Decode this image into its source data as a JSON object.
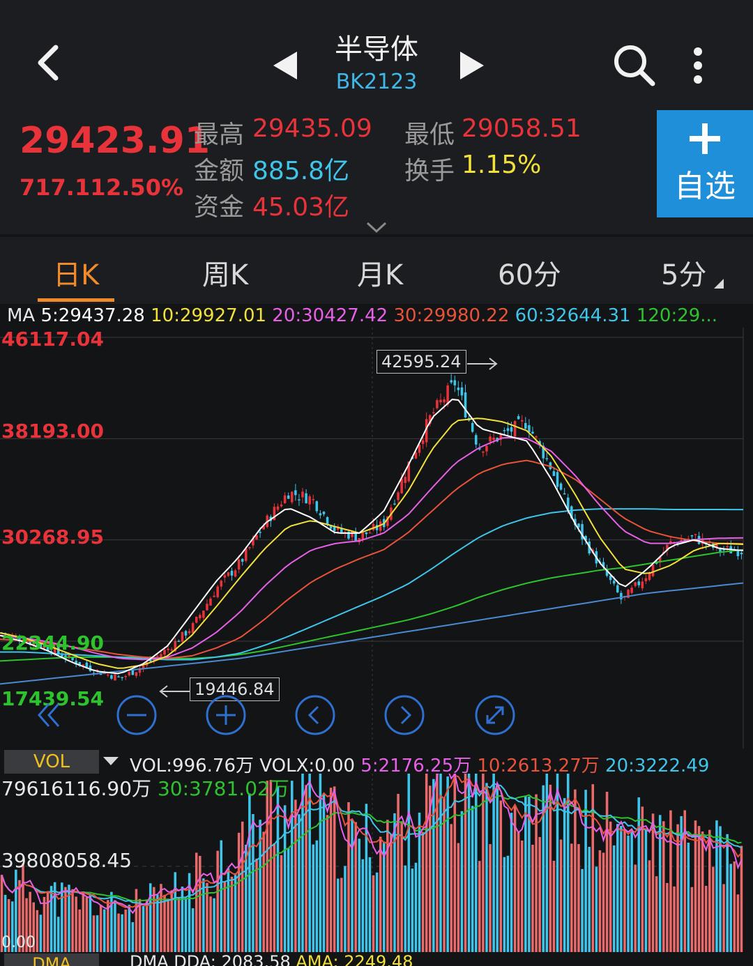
{
  "header": {
    "title": "半导体",
    "code": "BK2123"
  },
  "quote": {
    "price": "29423.91",
    "change": "717.11",
    "change_pct": "2.50%",
    "high_label": "最高",
    "high": "29435.09",
    "low_label": "最低",
    "low": "29058.51",
    "amount_label": "金额",
    "amount": "885.8亿",
    "turnover_label": "换手",
    "turnover": "1.15%",
    "capital_label": "资金",
    "capital": "45.03亿",
    "add_button_label": "自选"
  },
  "tabs": [
    {
      "label": "日K",
      "active": true
    },
    {
      "label": "周K",
      "active": false
    },
    {
      "label": "月K",
      "active": false
    },
    {
      "label": "60分",
      "active": false
    },
    {
      "label": "5分",
      "active": false
    }
  ],
  "ma": {
    "prefix": "MA",
    "ma5": "5:29437.28",
    "ma10": "10:29927.01",
    "ma20": "20:30427.42",
    "ma30": "30:29980.22",
    "ma60": "60:32644.31",
    "ma120": "120:29..."
  },
  "price_axis": {
    "top": "46117.04",
    "upper": "38193.00",
    "mid": "30268.95",
    "lower": "22344.90",
    "bottom": "17439.54"
  },
  "annotations": {
    "max_label": "42595.24",
    "min_label": "19446.84"
  },
  "volume": {
    "badge": "VOL",
    "vol": "VOL:996.76万",
    "volx": "VOLX:0.00",
    "ma5": "5:2176.25万",
    "ma10": "10:2613.27万",
    "ma20": "20:3222.49",
    "ma30": "30:3781.02万",
    "axis_top": "79616116.90",
    "axis_top_unit": "万",
    "axis_mid": "39808058.45",
    "axis_bottom": "0.00"
  },
  "dma": {
    "badge": "DMA",
    "ddd": "DMA DDA: 2083.58",
    "ama": "AMA: 2249.48"
  },
  "colors": {
    "up": "#e8333a",
    "down": "#3fc4ea",
    "ma5": "#ffffff",
    "ma10": "#f1e13a",
    "ma20": "#e860e8",
    "ma30": "#e8533a",
    "ma60": "#3fc4ea",
    "ma120": "#2ec22e",
    "ma250": "#4a8ad0"
  },
  "chart_data": {
    "type": "candlestick",
    "ylim": [
      17439.54,
      46117.04
    ],
    "close_path": [
      23000,
      22400,
      21800,
      20800,
      20000,
      19447,
      20500,
      21800,
      23500,
      26500,
      28500,
      31500,
      34000,
      33500,
      31000,
      30500,
      31500,
      36000,
      40000,
      42595,
      37500,
      38500,
      39500,
      36000,
      31500,
      28500,
      25500,
      27500,
      30000,
      30500,
      29500,
      29424
    ],
    "ma5": [
      22800,
      22300,
      21600,
      20700,
      20000,
      19800,
      20600,
      22000,
      24500,
      27000,
      29000,
      31500,
      32800,
      32000,
      30800,
      30800,
      32500,
      36000,
      39800,
      41500,
      39000,
      38500,
      38000,
      35000,
      31500,
      28500,
      26500,
      28000,
      29800,
      30300,
      29600,
      29437
    ],
    "ma10": [
      23000,
      22600,
      22000,
      21300,
      20600,
      20200,
      20500,
      21200,
      22800,
      25000,
      27300,
      29500,
      31300,
      31800,
      31300,
      30800,
      31500,
      34000,
      37300,
      39600,
      39800,
      39500,
      38800,
      36800,
      33800,
      30500,
      28000,
      27600,
      28300,
      29500,
      30000,
      29927
    ],
    "ma20": [
      22800,
      22600,
      22300,
      21900,
      21400,
      21000,
      20900,
      21100,
      21800,
      23000,
      24600,
      26600,
      28300,
      29500,
      30000,
      30200,
      30800,
      32200,
      34300,
      36300,
      37500,
      38300,
      38200,
      37200,
      35300,
      33000,
      31000,
      30000,
      30000,
      30300,
      30400,
      30427
    ],
    "ma30": [
      22500,
      22400,
      22200,
      21900,
      21600,
      21300,
      21100,
      21000,
      21200,
      21800,
      22600,
      24000,
      25600,
      27000,
      28000,
      28800,
      29500,
      30800,
      32500,
      34200,
      35500,
      36200,
      36500,
      36000,
      35000,
      33500,
      32000,
      31000,
      30500,
      30200,
      30000,
      29980
    ],
    "ma60": [
      21500,
      21500,
      21400,
      21300,
      21200,
      21100,
      21000,
      20900,
      20900,
      21100,
      21400,
      22000,
      22700,
      23500,
      24300,
      25100,
      25900,
      26800,
      28000,
      29300,
      30500,
      31400,
      32000,
      32400,
      32600,
      32700,
      32700,
      32700,
      32650,
      32650,
      32650,
      32644
    ],
    "ma120": [
      20800,
      20900,
      21000,
      21100,
      21100,
      21100,
      21100,
      21000,
      21000,
      21100,
      21300,
      21600,
      22000,
      22400,
      22800,
      23200,
      23600,
      24000,
      24500,
      25100,
      25800,
      26400,
      26900,
      27300,
      27600,
      27900,
      28100,
      28400,
      28700,
      29000,
      29300,
      29500
    ],
    "ma250": [
      19000,
      19200,
      19400,
      19600,
      19800,
      20000,
      20200,
      20400,
      20600,
      20800,
      21000,
      21300,
      21600,
      21900,
      22200,
      22500,
      22800,
      23100,
      23400,
      23700,
      24000,
      24300,
      24600,
      24900,
      25200,
      25500,
      25800,
      26100,
      26300,
      26500,
      26700,
      26900
    ]
  }
}
